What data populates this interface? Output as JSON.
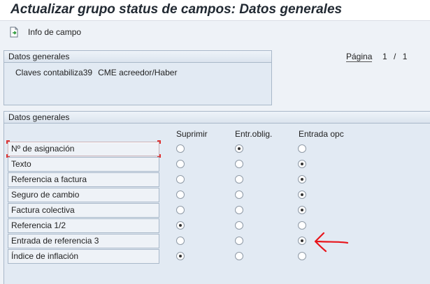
{
  "title": "Actualizar grupo status de campos: Datos generales",
  "toolbar": {
    "field_info_label": "Info de campo",
    "field_info_icon": "field-info-icon"
  },
  "pager": {
    "label": "Página",
    "current": "1",
    "separator": "/",
    "total": "1"
  },
  "header_group": {
    "title": "Datos generales",
    "code": "Claves contabiliza39",
    "description": "CME acreedor/Haber"
  },
  "fields_group": {
    "title": "Datos generales",
    "columns": [
      "Suprimir",
      "Entr.oblig.",
      "Entrada opc"
    ],
    "rows": [
      {
        "label": "Nº de asignación",
        "selected": "Entr.oblig."
      },
      {
        "label": "Texto",
        "selected": "Entrada opc"
      },
      {
        "label": "Referencia a factura",
        "selected": "Entrada opc"
      },
      {
        "label": "Seguro de cambio",
        "selected": "Entrada opc"
      },
      {
        "label": "Factura colectiva",
        "selected": "Entrada opc"
      },
      {
        "label": "Referencia 1/2",
        "selected": "Suprimir"
      },
      {
        "label": "Entrada de referencia 3",
        "selected": "Entrada opc"
      },
      {
        "label": "Índice de inflación",
        "selected": "Suprimir"
      }
    ]
  },
  "colors": {
    "annotation_arrow": "#e8151b"
  }
}
